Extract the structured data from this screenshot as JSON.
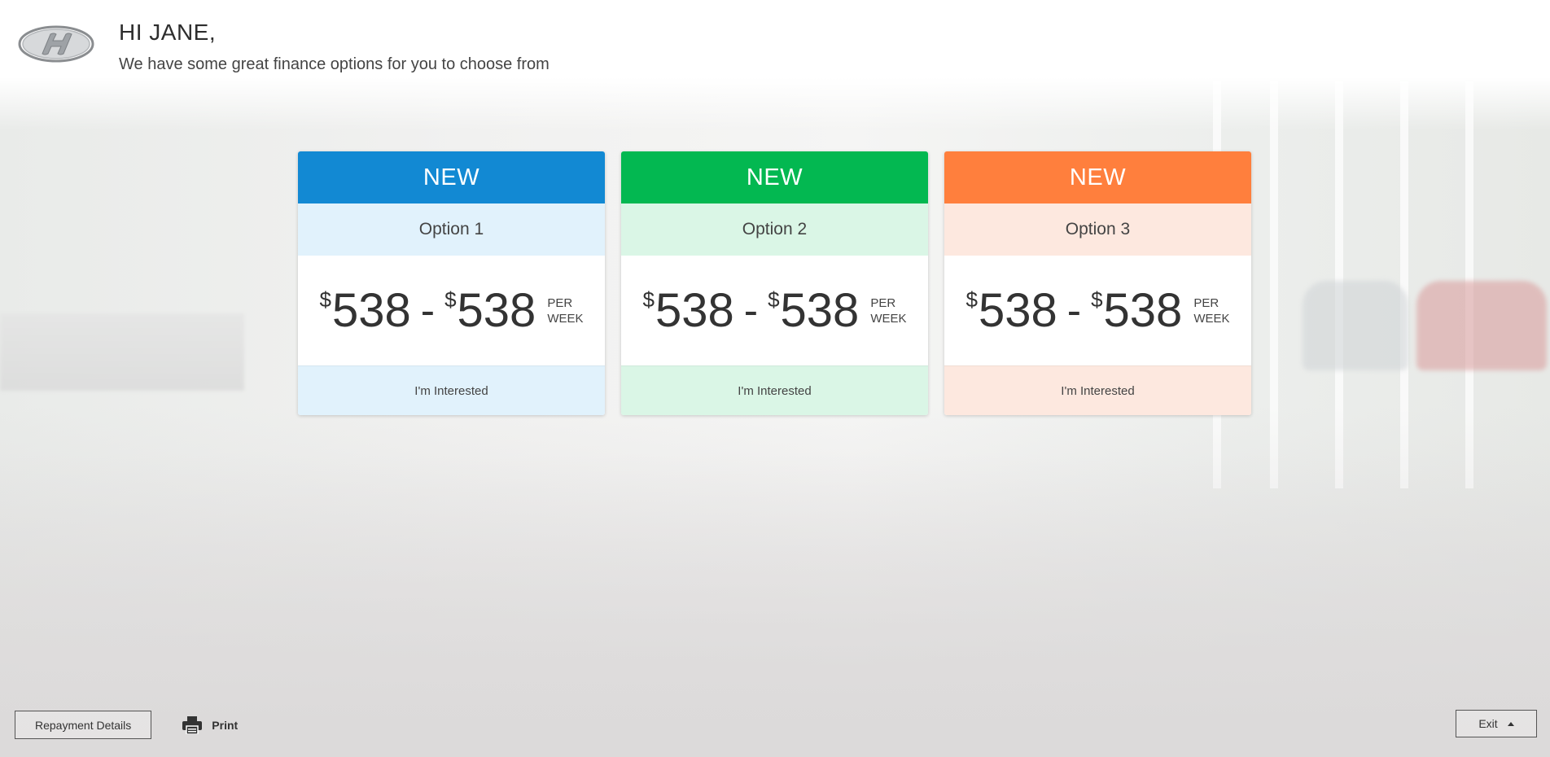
{
  "header": {
    "greeting": "HI JANE,",
    "subtitle": "We have some great finance options for you to choose from",
    "logo_icon": "hyundai-logo"
  },
  "options": [
    {
      "badge": "NEW",
      "name": "Option 1",
      "price_min": "538",
      "price_max": "538",
      "currency": "$",
      "separator": "-",
      "per_line1": "PER",
      "per_line2": "WEEK",
      "cta": "I'm Interested",
      "head_color": "#1289d3",
      "tint_color": "#e1f2fc"
    },
    {
      "badge": "NEW",
      "name": "Option 2",
      "price_min": "538",
      "price_max": "538",
      "currency": "$",
      "separator": "-",
      "per_line1": "PER",
      "per_line2": "WEEK",
      "cta": "I'm Interested",
      "head_color": "#03b851",
      "tint_color": "#daf6e6"
    },
    {
      "badge": "NEW",
      "name": "Option 3",
      "price_min": "538",
      "price_max": "538",
      "currency": "$",
      "separator": "-",
      "per_line1": "PER",
      "per_line2": "WEEK",
      "cta": "I'm Interested",
      "head_color": "#ff7f3d",
      "tint_color": "#fde8df"
    }
  ],
  "footer": {
    "repayment_label": "Repayment Details",
    "print_label": "Print",
    "print_icon": "printer-icon",
    "exit_label": "Exit",
    "exit_icon": "caret-up-icon"
  }
}
